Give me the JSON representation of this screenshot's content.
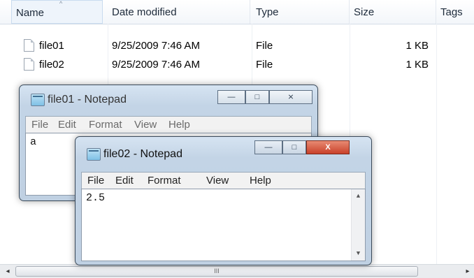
{
  "explorer": {
    "columns": [
      "Name",
      "Date modified",
      "Type",
      "Size",
      "Tags"
    ],
    "sort_indicator": "^",
    "rows": [
      {
        "name": "file01",
        "date": "9/25/2009 7:46 AM",
        "type": "File",
        "size": "1 KB"
      },
      {
        "name": "file02",
        "date": "9/25/2009 7:46 AM",
        "type": "File",
        "size": "1 KB"
      }
    ],
    "scroll": {
      "left": "◂",
      "right": "▸",
      "thumb": "III"
    }
  },
  "notepad1": {
    "title": "file01 - Notepad",
    "menu": [
      "File",
      "Edit",
      "Format",
      "View",
      "Help"
    ],
    "content": "a",
    "controls": {
      "min": "—",
      "max": "□",
      "close": "⨯"
    },
    "state": "inactive"
  },
  "notepad2": {
    "title": "file02 - Notepad",
    "menu": [
      "File",
      "Edit",
      "Format",
      "View",
      "Help"
    ],
    "content": "2.5",
    "controls": {
      "min": "—",
      "max": "□",
      "close": "X"
    },
    "scroll": {
      "up": "▲",
      "down": "▼"
    },
    "state": "active"
  },
  "icons": {
    "file": "file-icon",
    "notepad": "notepad-icon"
  },
  "colors": {
    "close_active": "#c9412a",
    "frame": "#c3d4e6"
  }
}
